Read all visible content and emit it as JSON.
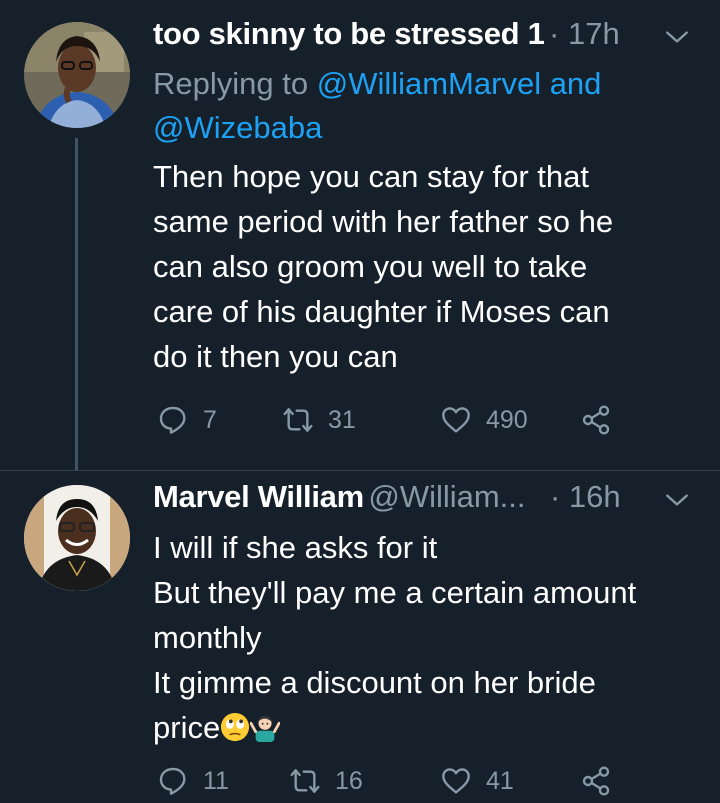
{
  "tweets": [
    {
      "name": "too skinny to be stressed 1",
      "time": "· 17h",
      "replying_prefix": "Replying to ",
      "mention1": "@WilliamMarvel and",
      "mention2": "@Wizebaba",
      "lines": [
        "Then hope you can stay for that",
        "same period with her father so he",
        "can also groom you well to take",
        "care of his daughter if Moses can",
        "do it then you can"
      ],
      "replies": "7",
      "retweets": "31",
      "likes": "490"
    },
    {
      "name": "Marvel William",
      "handle": "@William...",
      "time": "· 16h",
      "lines": [
        "I will if she asks for it",
        "But they'll pay me a certain amount",
        "monthly",
        "It gimme a discount on her bride",
        "price"
      ],
      "emojis": [
        "face-with-rolling-eyes-icon",
        "person-shrugging-icon"
      ],
      "replies": "11",
      "retweets": "16",
      "likes": "41"
    }
  ],
  "colors": {
    "background": "#15202b",
    "secondary_text": "#8899a6",
    "mention": "#1da1f2",
    "thread_line": "#3d5466",
    "divider": "#38444d"
  }
}
